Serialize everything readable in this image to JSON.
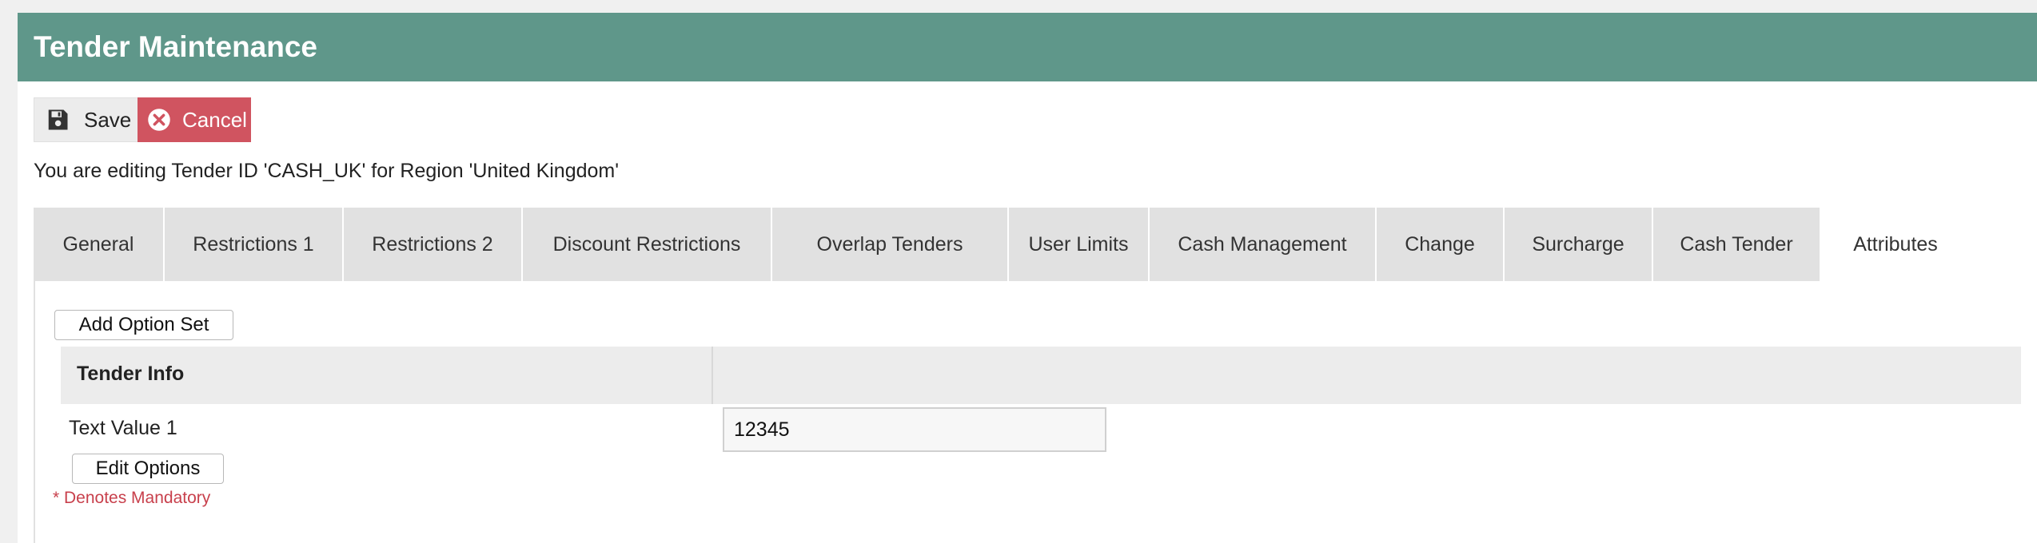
{
  "window": {
    "title": "Tender Maintenance"
  },
  "toolbar": {
    "save_label": "Save",
    "cancel_label": "Cancel",
    "save_icon": "floppy-disk-icon",
    "cancel_icon": "x-circle-icon"
  },
  "editing_note": "You are editing Tender ID 'CASH_UK' for Region 'United Kingdom'",
  "tabs": [
    {
      "label": "General"
    },
    {
      "label": "Restrictions 1"
    },
    {
      "label": "Restrictions 2"
    },
    {
      "label": "Discount Restrictions"
    },
    {
      "label": "Overlap Tenders"
    },
    {
      "label": "User Limits"
    },
    {
      "label": "Cash Management"
    },
    {
      "label": "Change"
    },
    {
      "label": "Surcharge"
    },
    {
      "label": "Cash Tender"
    },
    {
      "label": "Attributes"
    }
  ],
  "active_tab": "Attributes",
  "attributes": {
    "add_option_set_label": "Add Option Set",
    "section_title": "Tender Info",
    "field_label": "Text Value 1",
    "field_value": "12345",
    "edit_options_label": "Edit Options",
    "mandatory_note": "* Denotes Mandatory"
  },
  "colors": {
    "header_bg": "#5f978a",
    "cancel_bg": "#d05460",
    "mandatory_text": "#c8404c"
  }
}
